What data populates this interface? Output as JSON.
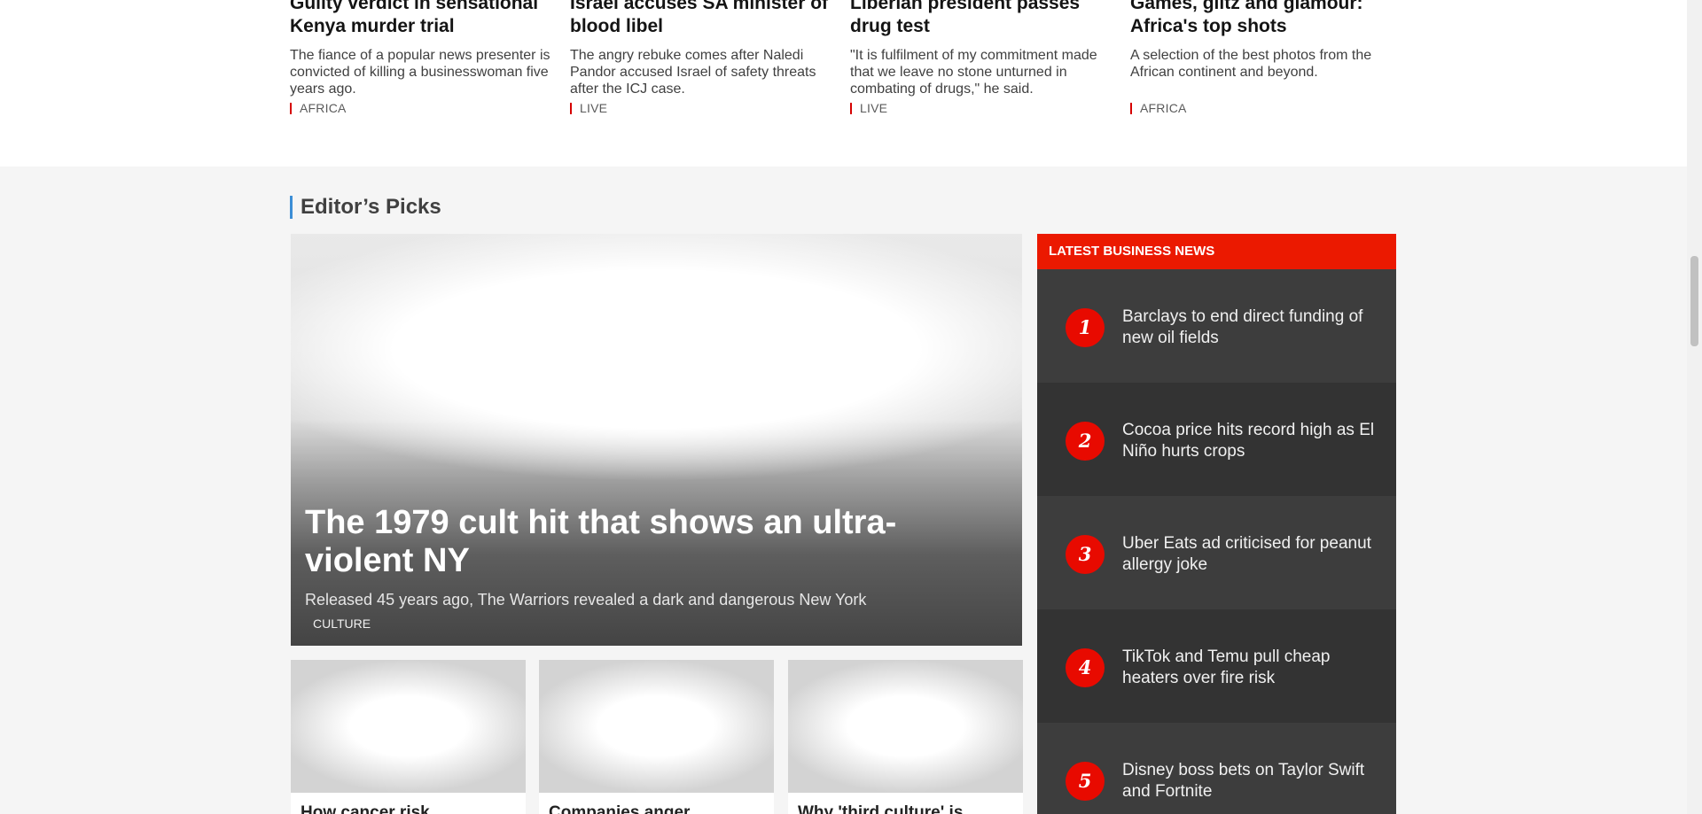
{
  "top_stories": [
    {
      "headline": "Guilty verdict in sensational Kenya murder trial",
      "summary": "The fiance of a popular news presenter is convicted of killing a businesswoman five years ago.",
      "tag": "AFRICA"
    },
    {
      "headline": "Israel accuses SA minister of blood libel",
      "summary": "The angry rebuke comes after Naledi Pandor accused Israel of safety threats after the ICJ case.",
      "tag": "LIVE"
    },
    {
      "headline": "Liberian president passes drug test",
      "summary": "\"It is fulfilment of my commitment made that we leave no stone unturned in combating of drugs,\" he said.",
      "tag": "LIVE"
    },
    {
      "headline": "Games, glitz and glamour: Africa's top shots",
      "summary": "A selection of the best photos from the African continent and beyond.",
      "tag": "AFRICA"
    }
  ],
  "editors_picks": {
    "heading": "Editor’s Picks",
    "hero": {
      "title": "The 1979 cult hit that shows an ultra-violent NY",
      "description": "Released 45 years ago, The Warriors revealed a dark and dangerous New York",
      "tag": "CULTURE"
    },
    "cards": [
      {
        "title": "How cancer risk"
      },
      {
        "title": "Companies anger"
      },
      {
        "title": "Why 'third culture' is"
      }
    ]
  },
  "business_news": {
    "header": "LATEST BUSINESS NEWS",
    "items": [
      {
        "number": "1",
        "text": "Barclays to end direct funding of new oil fields"
      },
      {
        "number": "2",
        "text": "Cocoa price hits record high as El Niño hurts crops"
      },
      {
        "number": "3",
        "text": "Uber Eats ad criticised for peanut allergy joke"
      },
      {
        "number": "4",
        "text": "TikTok and Temu pull cheap heaters over fire risk"
      },
      {
        "number": "5",
        "text": "Disney boss bets on Taylor Swift and Fortnite"
      }
    ]
  },
  "colors": {
    "accent_red": "#eb1900",
    "tag_red": "#d60000",
    "section_blue": "#3c8ed6",
    "panel_dark": "#3d3d3d"
  }
}
